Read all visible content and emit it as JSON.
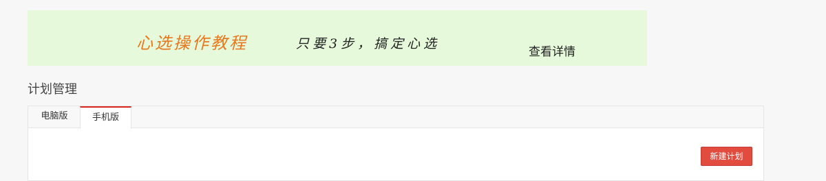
{
  "banner": {
    "title": "心选操作教程",
    "slogan": "只要3步，搞定心选",
    "detail_link": "查看详情",
    "background_color": "#e6fadb",
    "title_color": "#e8781f"
  },
  "page": {
    "title": "计划管理"
  },
  "tabs": [
    {
      "label": "电脑版",
      "active": false
    },
    {
      "label": "手机版",
      "active": true
    }
  ],
  "actions": {
    "new_plan_label": "新建计划",
    "new_plan_color": "#e24c3f"
  },
  "accent_color": "#d9241c"
}
